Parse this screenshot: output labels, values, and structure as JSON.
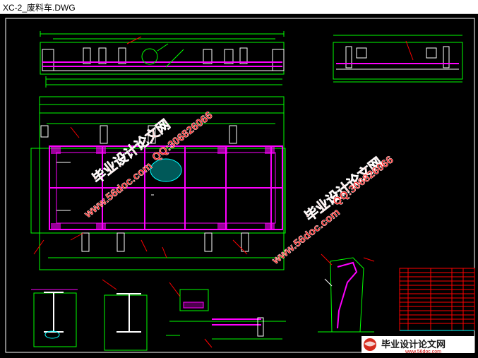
{
  "window": {
    "title": "XC-2_废料车.DWG"
  },
  "watermarks": {
    "site_name": "毕业设计论文网",
    "site_url": "www.56doc.com",
    "qq": "QQ:306826066"
  },
  "footer_logo": {
    "name": "毕业设计论文网",
    "url": "www.56doc.com"
  },
  "colors": {
    "background": "#000000",
    "line_green": "#00ff00",
    "line_magenta": "#ff00ff",
    "line_red": "#ff0000",
    "line_white": "#ffffff",
    "line_cyan": "#00ffff",
    "line_yellow": "#ffff00",
    "watermark_red": "#ff1a1a"
  }
}
